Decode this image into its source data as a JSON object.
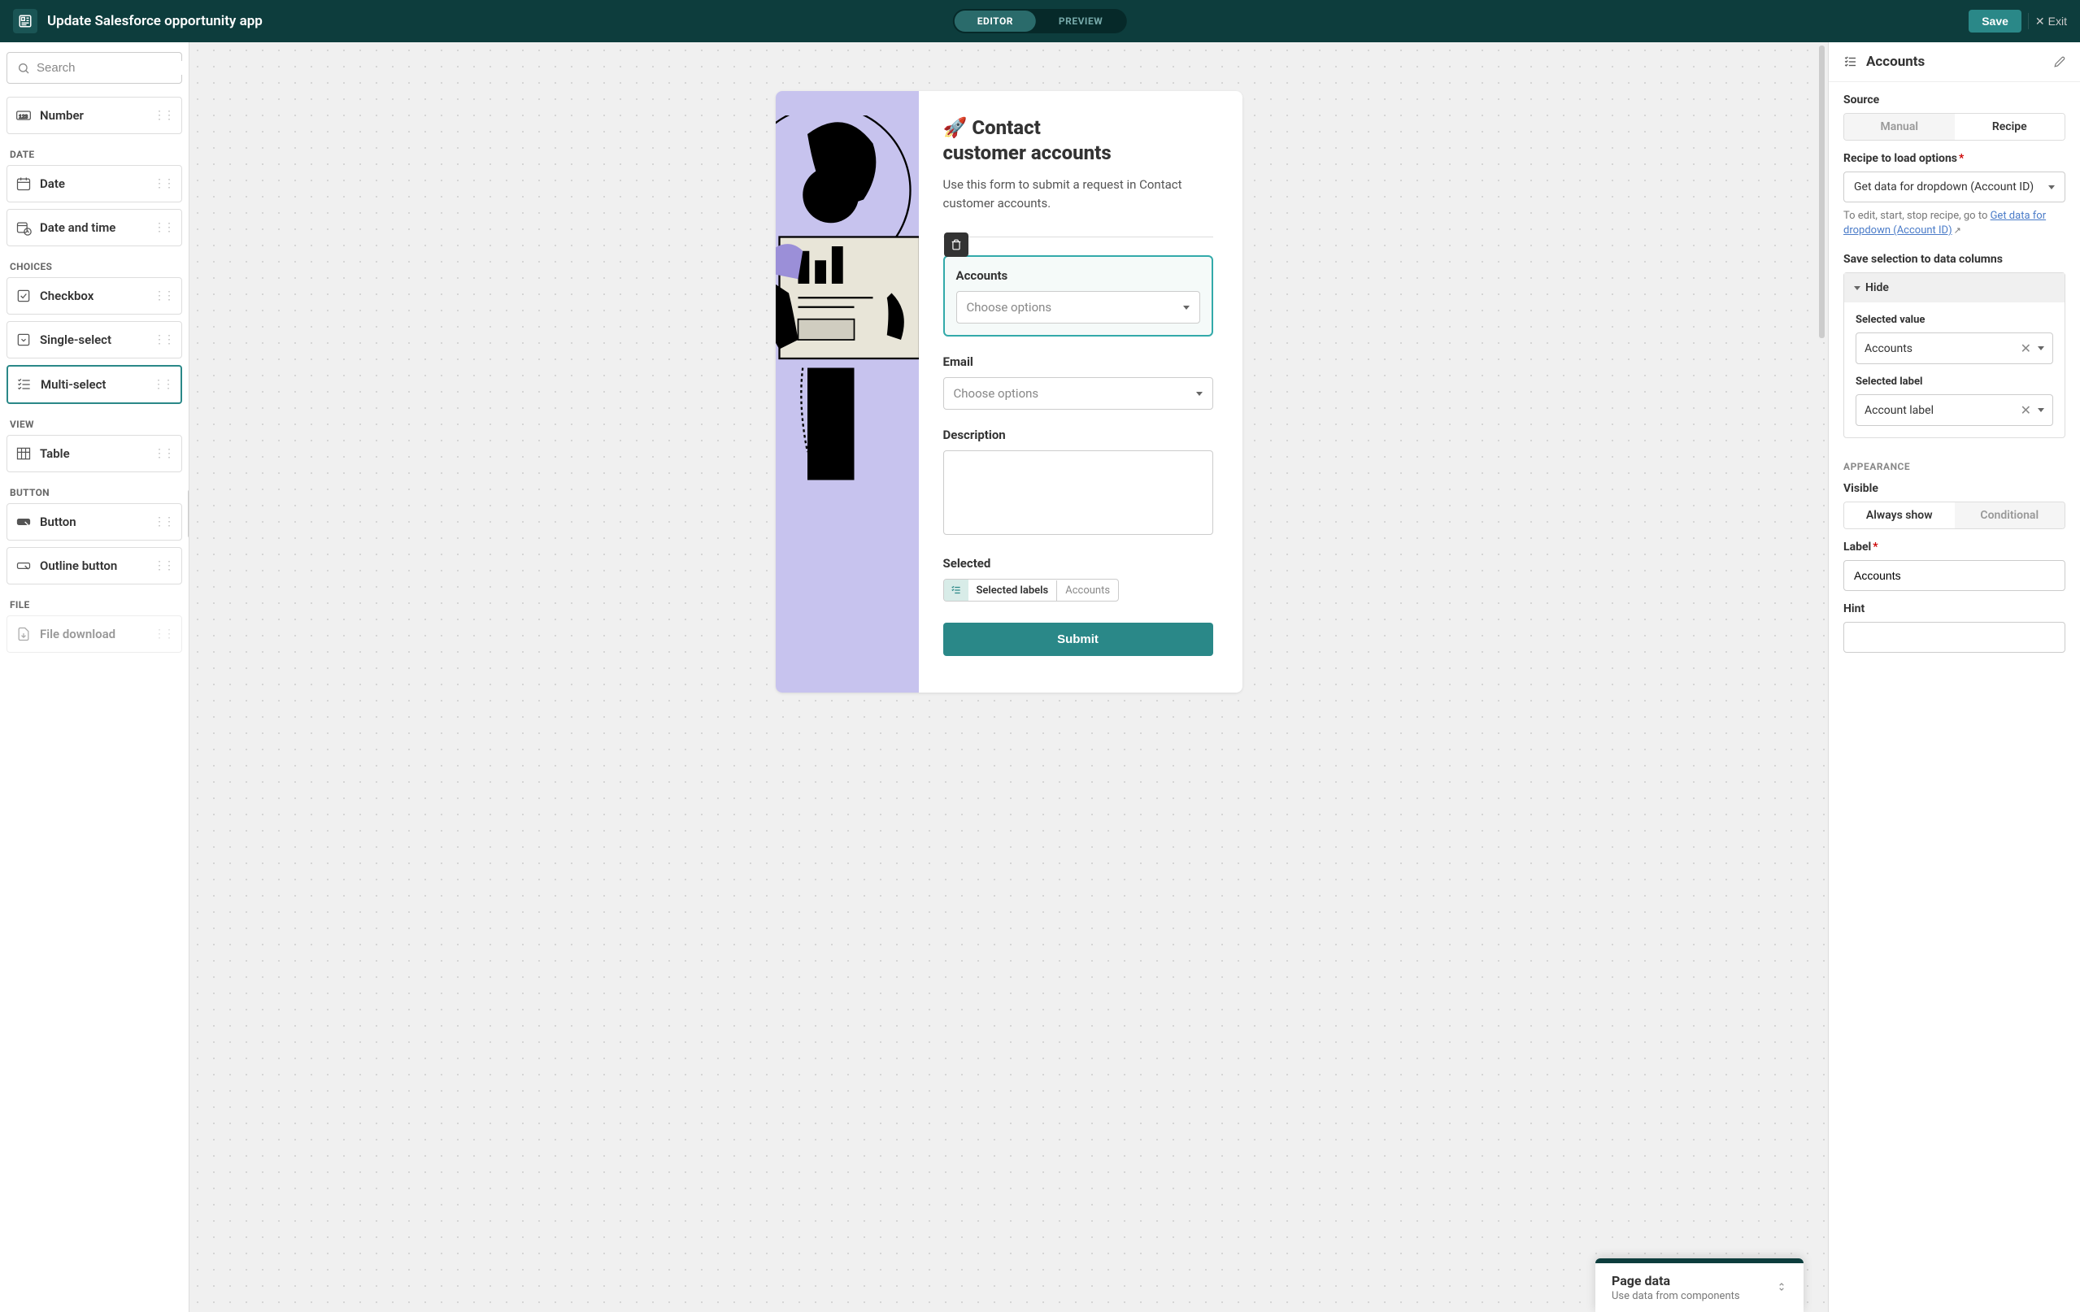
{
  "header": {
    "title": "Update Salesforce opportunity app",
    "editor_tab": "EDITOR",
    "preview_tab": "PREVIEW",
    "save": "Save",
    "exit": "Exit"
  },
  "sidebar": {
    "search_placeholder": "Search",
    "categories": {
      "number": {
        "items": [
          {
            "label": "Number"
          }
        ]
      },
      "date": {
        "label": "DATE",
        "items": [
          {
            "label": "Date"
          },
          {
            "label": "Date and time"
          }
        ]
      },
      "choices": {
        "label": "CHOICES",
        "items": [
          {
            "label": "Checkbox"
          },
          {
            "label": "Single-select"
          },
          {
            "label": "Multi-select"
          }
        ]
      },
      "view": {
        "label": "VIEW",
        "items": [
          {
            "label": "Table"
          }
        ]
      },
      "button": {
        "label": "BUTTON",
        "items": [
          {
            "label": "Button"
          },
          {
            "label": "Outline button"
          }
        ]
      },
      "file": {
        "label": "FILE",
        "items": [
          {
            "label": "File download"
          }
        ]
      }
    }
  },
  "form": {
    "title_line1": "🚀 Contact",
    "title_line2": "customer accounts",
    "subtitle": "Use this form to submit a request in Contact customer accounts.",
    "accounts_label": "Accounts",
    "accounts_placeholder": "Choose options",
    "email_label": "Email",
    "email_placeholder": "Choose options",
    "description_label": "Description",
    "selected_label": "Selected",
    "pill_primary": "Selected labels",
    "pill_secondary": "Accounts",
    "submit": "Submit"
  },
  "popup": {
    "title": "Page data",
    "subtitle": "Use data from components"
  },
  "panel": {
    "title": "Accounts",
    "source_label": "Source",
    "source_manual": "Manual",
    "source_recipe": "Recipe",
    "recipe_label": "Recipe to load options",
    "recipe_value": "Get data for dropdown (Account ID)",
    "recipe_hint_prefix": "To edit, start, stop recipe, go to ",
    "recipe_hint_link": "Get data for dropdown (Account ID)",
    "save_columns_label": "Save selection to data columns",
    "hide": "Hide",
    "selected_value_label": "Selected value",
    "selected_value": "Accounts",
    "selected_label_label": "Selected label",
    "selected_label_value": "Account label",
    "appearance": "APPEARANCE",
    "visible_label": "Visible",
    "visible_always": "Always show",
    "visible_conditional": "Conditional",
    "label_label": "Label",
    "label_value": "Accounts",
    "hint_label": "Hint"
  }
}
